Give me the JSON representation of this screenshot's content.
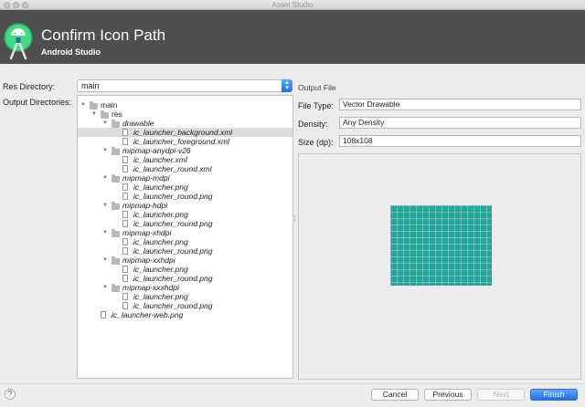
{
  "window": {
    "title": "Asset Studio"
  },
  "header": {
    "title": "Confirm Icon Path",
    "subtitle": "Android Studio"
  },
  "res_directory": {
    "label": "Res Directory:",
    "value": "main"
  },
  "output_directories": {
    "label": "Output Directories:",
    "tree": [
      {
        "text": "main",
        "kind": "folder",
        "depth": 0,
        "expanded": true
      },
      {
        "text": "res",
        "kind": "folder",
        "depth": 1,
        "expanded": true
      },
      {
        "text": "drawable",
        "kind": "folder",
        "depth": 2,
        "expanded": true,
        "italic": true
      },
      {
        "text": "ic_launcher_background.xml",
        "kind": "file",
        "depth": 3,
        "italic": true,
        "selected": true
      },
      {
        "text": "ic_launcher_foreground.xml",
        "kind": "file",
        "depth": 3,
        "italic": true
      },
      {
        "text": "mipmap-anydpi-v26",
        "kind": "folder",
        "depth": 2,
        "expanded": true,
        "italic": true
      },
      {
        "text": "ic_launcher.xml",
        "kind": "file",
        "depth": 3,
        "italic": true
      },
      {
        "text": "ic_launcher_round.xml",
        "kind": "file",
        "depth": 3,
        "italic": true
      },
      {
        "text": "mipmap-mdpi",
        "kind": "folder",
        "depth": 2,
        "expanded": true,
        "italic": true
      },
      {
        "text": "ic_launcher.png",
        "kind": "file",
        "depth": 3,
        "italic": true
      },
      {
        "text": "ic_launcher_round.png",
        "kind": "file",
        "depth": 3,
        "italic": true
      },
      {
        "text": "mipmap-hdpi",
        "kind": "folder",
        "depth": 2,
        "expanded": true,
        "italic": true
      },
      {
        "text": "ic_launcher.png",
        "kind": "file",
        "depth": 3,
        "italic": true
      },
      {
        "text": "ic_launcher_round.png",
        "kind": "file",
        "depth": 3,
        "italic": true
      },
      {
        "text": "mipmap-xhdpi",
        "kind": "folder",
        "depth": 2,
        "expanded": true,
        "italic": true
      },
      {
        "text": "ic_launcher.png",
        "kind": "file",
        "depth": 3,
        "italic": true
      },
      {
        "text": "ic_launcher_round.png",
        "kind": "file",
        "depth": 3,
        "italic": true
      },
      {
        "text": "mipmap-xxhdpi",
        "kind": "folder",
        "depth": 2,
        "expanded": true,
        "italic": true
      },
      {
        "text": "ic_launcher.png",
        "kind": "file",
        "depth": 3,
        "italic": true
      },
      {
        "text": "ic_launcher_round.png",
        "kind": "file",
        "depth": 3,
        "italic": true
      },
      {
        "text": "mipmap-xxxhdpi",
        "kind": "folder",
        "depth": 2,
        "expanded": true,
        "italic": true
      },
      {
        "text": "ic_launcher.png",
        "kind": "file",
        "depth": 3,
        "italic": true
      },
      {
        "text": "ic_launcher_round.png",
        "kind": "file",
        "depth": 3,
        "italic": true
      },
      {
        "text": "ic_launcher-web.png",
        "kind": "file",
        "depth": 1,
        "italic": true
      }
    ]
  },
  "output_file": {
    "label": "Output File",
    "file_type": {
      "label": "File Type:",
      "value": "Vector Drawable"
    },
    "density": {
      "label": "Density:",
      "value": "Any Density"
    },
    "size": {
      "label": "Size (dp):",
      "value": "108x108"
    }
  },
  "preview": {
    "color": "#26a69a"
  },
  "footer": {
    "help": "?",
    "cancel": "Cancel",
    "previous": "Previous",
    "next": "Next",
    "finish": "Finish"
  },
  "colors": {
    "header_bg": "#4f4f4f",
    "accent": "#1d6ff0",
    "selection": "#dcdcdc"
  }
}
